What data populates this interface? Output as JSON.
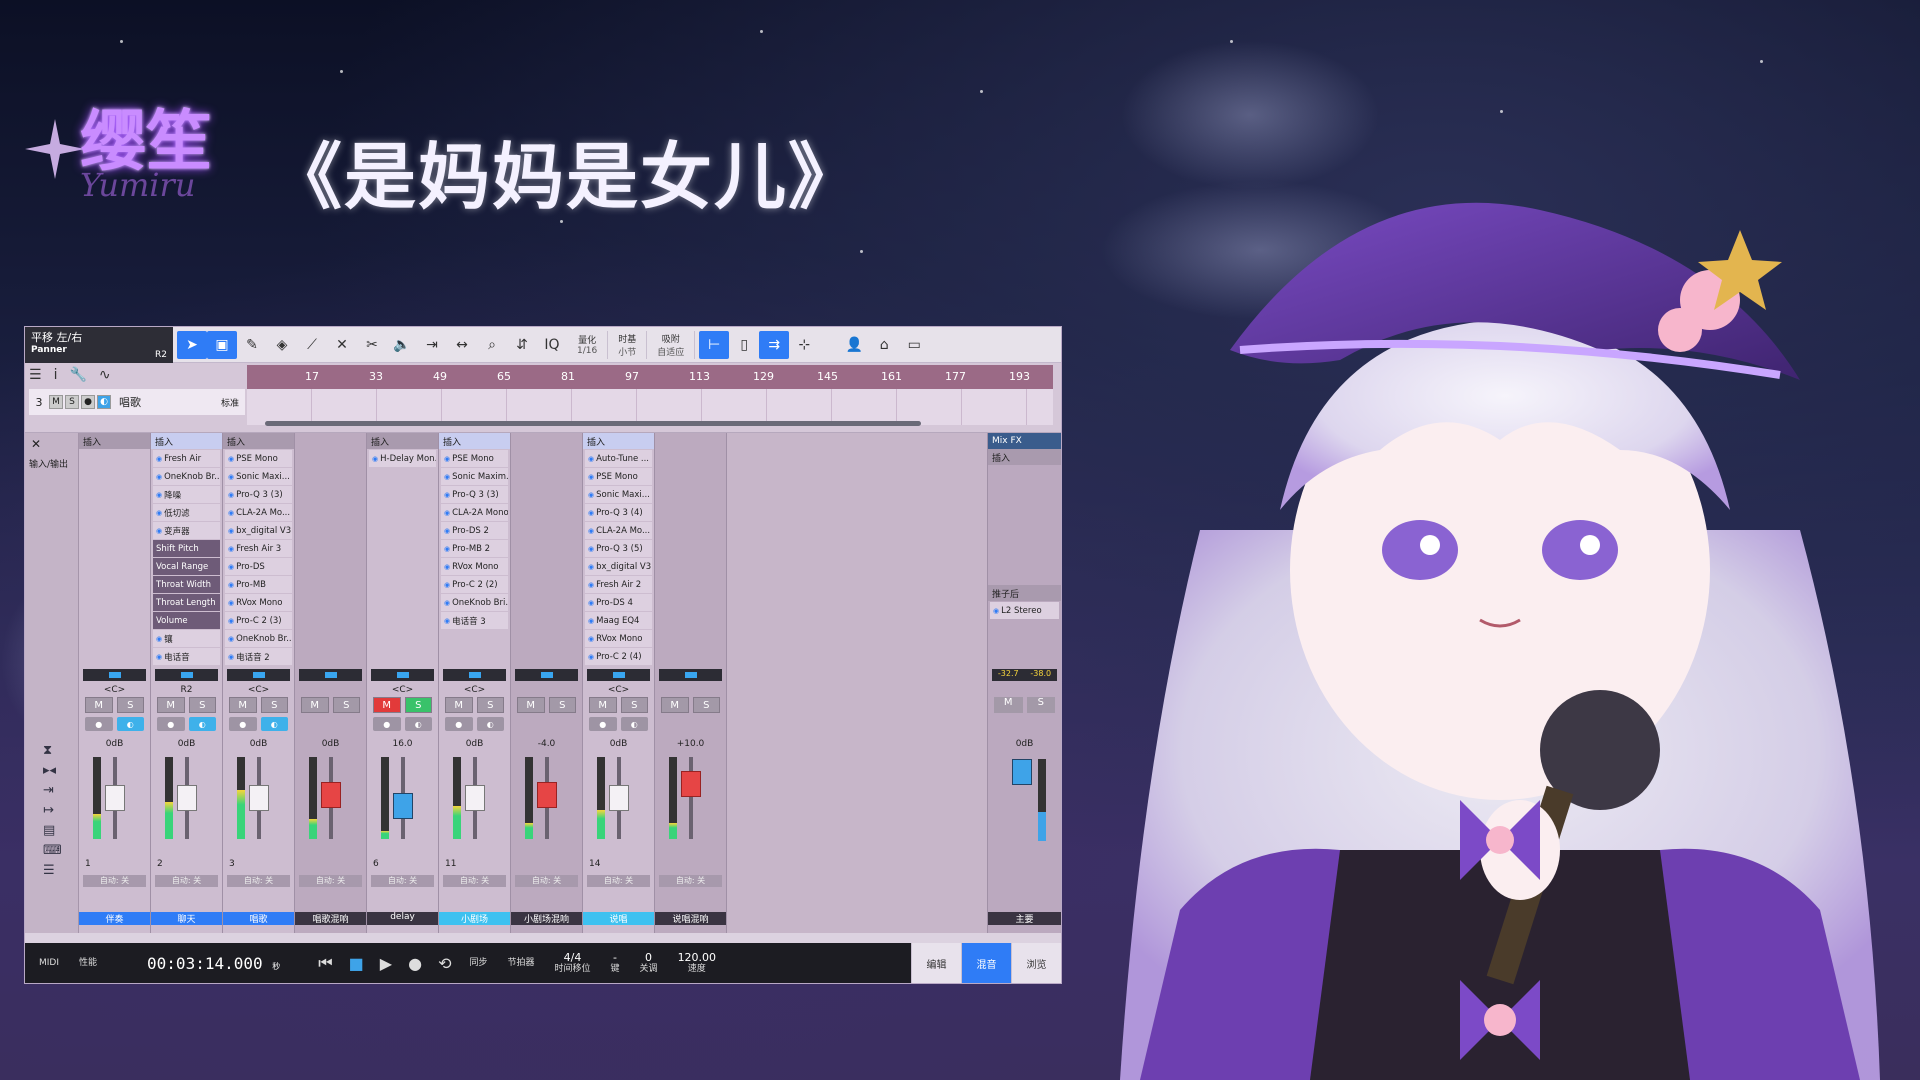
{
  "title": "《是妈妈是女儿》",
  "logo": {
    "text": "缨笙",
    "sub": "Yumiru"
  },
  "daw": {
    "track_info": {
      "line1": "平移 左/右",
      "line2": "Panner",
      "line3": "R2"
    },
    "toolbar": {
      "quantize_label": "量化",
      "quantize_value": "1/16",
      "timebase_label": "时基",
      "timebase_value": "小节",
      "snap_label": "吸附",
      "snap_value": "自适应"
    },
    "ruler_marks": [
      "17",
      "33",
      "49",
      "65",
      "81",
      "97",
      "113",
      "129",
      "145",
      "161",
      "177",
      "193"
    ],
    "track": {
      "number": "3",
      "name": "唱歌",
      "view": "标准"
    },
    "mixer": {
      "left_label": "输入/输出",
      "channels": [
        {
          "num": "1",
          "name": "伴奏",
          "vol": "0dB",
          "pan": "<C>",
          "name_style": "blue",
          "meter": 0.3,
          "fader": 0.5,
          "insert_title": "插入",
          "plugins": []
        },
        {
          "num": "2",
          "name": "聊天",
          "vol": "0dB",
          "pan": "R2",
          "name_style": "blue",
          "meter": 0.45,
          "fader": 0.5,
          "insert_title": "插入",
          "plugins": [
            "Fresh Air",
            "OneKnob Br...",
            "降噪",
            "低切滤",
            "变声器",
            "Shift Pitch",
            "Vocal Range",
            "Throat Width",
            "Throat Length",
            "Volume",
            "镶",
            "电话音"
          ]
        },
        {
          "num": "3",
          "name": "唱歌",
          "vol": "0dB",
          "pan": "<C>",
          "name_style": "blue",
          "meter": 0.6,
          "fader": 0.5,
          "insert_title": "插入",
          "plugins": [
            "PSE Mono",
            "Sonic Maxi...",
            "Pro-Q 3 (3)",
            "CLA-2A Mo...",
            "bx_digital V3",
            "Fresh Air 3",
            "Pro-DS",
            "Pro-MB",
            "RVox Mono",
            "Pro-C 2 (3)",
            "OneKnob Br...",
            "电话音 2"
          ]
        },
        {
          "num": "",
          "name": "唱歌混响",
          "vol": "0dB",
          "pan": "",
          "name_style": "dark",
          "meter": 0.25,
          "fader": 0.55,
          "insert_title": "",
          "plugins": []
        },
        {
          "num": "6",
          "name": "delay",
          "vol": "16.0",
          "pan": "<C>",
          "name_style": "dark",
          "meter": 0.1,
          "fader": 0.35,
          "insert_title": "插入",
          "plugins": [
            "H-Delay Mon..."
          ]
        },
        {
          "num": "11",
          "name": "小剧场",
          "vol": "0dB",
          "pan": "<C>",
          "name_style": "lblue",
          "meter": 0.4,
          "fader": 0.5,
          "insert_title": "插入",
          "plugins": [
            "PSE Mono",
            "Sonic Maxim...",
            "Pro-Q 3 (3)",
            "CLA-2A Mono",
            "Pro-DS 2",
            "Pro-MB 2",
            "RVox Mono",
            "Pro-C 2 (2)",
            "OneKnob Bri...",
            "电话音 3"
          ]
        },
        {
          "num": "",
          "name": "小剧场混响",
          "vol": "-4.0",
          "pan": "",
          "name_style": "dark",
          "meter": 0.2,
          "fader": 0.55,
          "insert_title": "",
          "plugins": []
        },
        {
          "num": "14",
          "name": "说唱",
          "vol": "0dB",
          "pan": "<C>",
          "name_style": "lblue",
          "meter": 0.35,
          "fader": 0.5,
          "insert_title": "插入",
          "plugins": [
            "Auto-Tune ...",
            "PSE Mono",
            "Sonic Maxi...",
            "Pro-Q 3 (4)",
            "CLA-2A Mo...",
            "Pro-Q 3 (5)",
            "bx_digital V3",
            "Fresh Air 2",
            "Pro-DS 4",
            "Maag EQ4",
            "RVox Mono",
            "Pro-C 2 (4)"
          ]
        },
        {
          "num": "",
          "name": "说唱混响",
          "vol": "+10.0",
          "pan": "",
          "name_style": "dark",
          "meter": 0.2,
          "fader": 0.75,
          "insert_title": "",
          "plugins": []
        }
      ],
      "master": {
        "header": "Mix FX",
        "insert_title": "插入",
        "post_title": "推子后",
        "plugin": "L2 Stereo",
        "peak_l": "-32.7",
        "peak_r": "-38.0",
        "vol": "0dB",
        "name": "主要"
      },
      "auto_label": "自动: 关"
    },
    "transport": {
      "midi": "MIDI",
      "perf": "性能",
      "time": "00:03:14.000",
      "time_unit": "秒",
      "sync": "同步",
      "metronome": "节拍器",
      "sig": "4/4",
      "sig_label": "时间移位",
      "key": "-",
      "key_label": "键",
      "transpose": "0",
      "transpose_label": "关调",
      "tempo": "120.00",
      "tempo_label": "速度"
    },
    "view_tabs": [
      "编辑",
      "混音",
      "浏览"
    ]
  }
}
